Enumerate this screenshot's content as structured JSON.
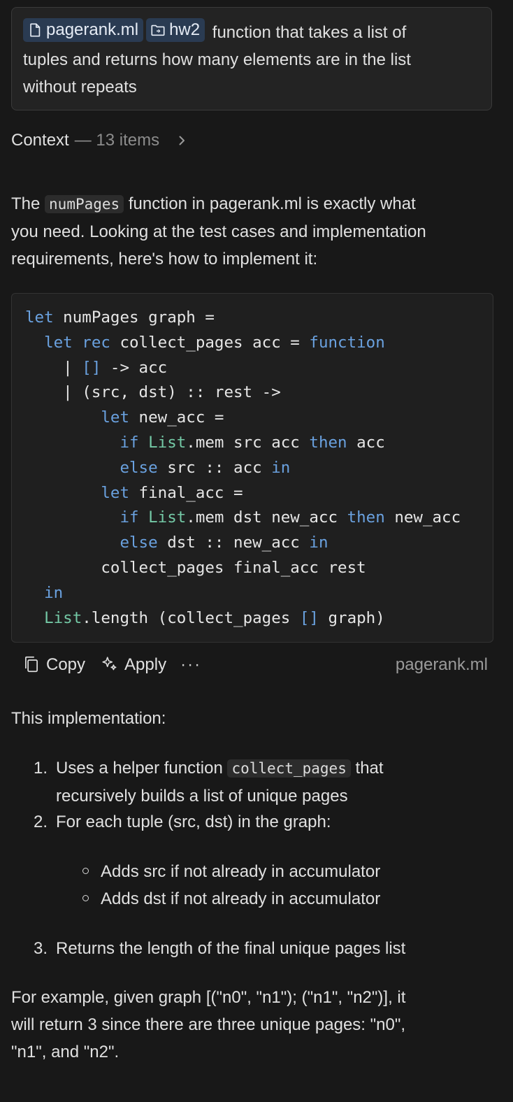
{
  "prompt": {
    "file_chip": "pagerank.ml",
    "folder_chip": "hw2",
    "text_line1": "function that takes a list of",
    "text_line2": "tuples and returns how many elements are in the list",
    "text_line3": "without repeats"
  },
  "context": {
    "label": "Context",
    "count": "— 13 items"
  },
  "intro": {
    "before": "The",
    "code": "numPages",
    "after_line1": "function in pagerank.ml is exactly what",
    "line2": "you need. Looking at the test cases and implementation",
    "line3": "requirements, here's how to implement it:"
  },
  "code_block": {
    "lines": [
      [
        [
          "kw",
          "let"
        ],
        [
          "t",
          " numPages graph ="
        ]
      ],
      [
        [
          "t",
          "  "
        ],
        [
          "kw",
          "let rec"
        ],
        [
          "t",
          " collect_pages acc = "
        ],
        [
          "kw",
          "function"
        ]
      ],
      [
        [
          "t",
          "    | "
        ],
        [
          "kw",
          "[]"
        ],
        [
          "t",
          " -> acc"
        ]
      ],
      [
        [
          "t",
          "    | (src, dst) :: rest ->"
        ]
      ],
      [
        [
          "t",
          "        "
        ],
        [
          "kw",
          "let"
        ],
        [
          "t",
          " new_acc ="
        ]
      ],
      [
        [
          "t",
          "          "
        ],
        [
          "kw",
          "if"
        ],
        [
          "t",
          " "
        ],
        [
          "mod",
          "List"
        ],
        [
          "t",
          ".mem src acc "
        ],
        [
          "kw",
          "then"
        ],
        [
          "t",
          " acc"
        ]
      ],
      [
        [
          "t",
          "          "
        ],
        [
          "kw",
          "else"
        ],
        [
          "t",
          " src :: acc "
        ],
        [
          "kw",
          "in"
        ]
      ],
      [
        [
          "t",
          "        "
        ],
        [
          "kw",
          "let"
        ],
        [
          "t",
          " final_acc ="
        ]
      ],
      [
        [
          "t",
          "          "
        ],
        [
          "kw",
          "if"
        ],
        [
          "t",
          " "
        ],
        [
          "mod",
          "List"
        ],
        [
          "t",
          ".mem dst new_acc "
        ],
        [
          "kw",
          "then"
        ],
        [
          "t",
          " new_acc"
        ]
      ],
      [
        [
          "t",
          "          "
        ],
        [
          "kw",
          "else"
        ],
        [
          "t",
          " dst :: new_acc "
        ],
        [
          "kw",
          "in"
        ]
      ],
      [
        [
          "t",
          "        collect_pages final_acc rest"
        ]
      ],
      [
        [
          "t",
          "  "
        ],
        [
          "kw",
          "in"
        ]
      ],
      [
        [
          "t",
          "  "
        ],
        [
          "mod",
          "List"
        ],
        [
          "t",
          ".length (collect_pages "
        ],
        [
          "kw",
          "[]"
        ],
        [
          "t",
          " graph)"
        ]
      ]
    ]
  },
  "toolbar": {
    "copy_label": "Copy",
    "apply_label": "Apply",
    "more_label": "···",
    "filename": "pagerank.ml"
  },
  "explanation": {
    "heading": "This implementation:",
    "step1_num": "1.",
    "step1_before": "Uses a helper function",
    "step1_code": "collect_pages",
    "step1_after": "that",
    "step1_line2": "recursively builds a list of unique pages",
    "step2_num": "2.",
    "step2_text": "For each tuple (src, dst) in the graph:",
    "sub1": "Adds src if not already in accumulator",
    "sub2": "Adds dst if not already in accumulator",
    "step3_num": "3.",
    "step3_text": "Returns the length of the final unique pages list",
    "example_line1": "For example, given graph [(\"n0\", \"n1\"); (\"n1\", \"n2\")], it",
    "example_line2": "will return 3 since there are three unique pages: \"n0\",",
    "example_line3": "\"n1\", and \"n2\"."
  },
  "colors": {
    "keyword": "#6aa1df",
    "module": "#74c9a6",
    "chip_bg": "#2a3b52"
  }
}
